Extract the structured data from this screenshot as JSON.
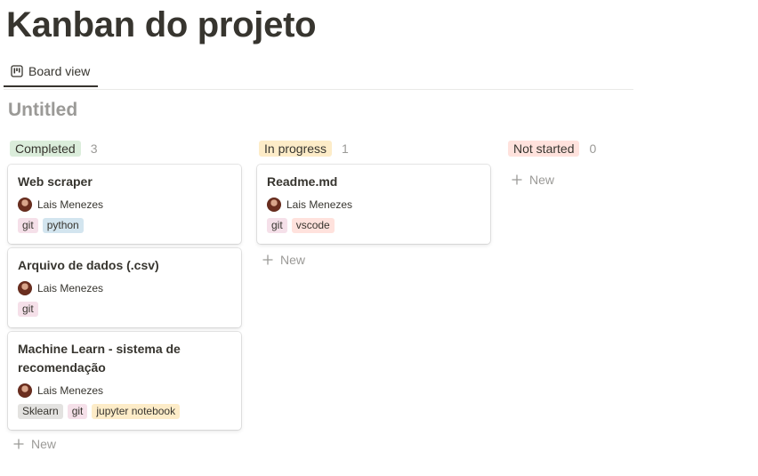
{
  "page": {
    "title": "Kanban do projeto"
  },
  "tabs": [
    {
      "label": "Board view",
      "icon": "board-icon"
    }
  ],
  "view": {
    "title": "Untitled"
  },
  "colors": {
    "text": "#37352f",
    "muted": "#9b9a97"
  },
  "columns": [
    {
      "status": "Completed",
      "count": "3",
      "color": "#dbeddb",
      "cards": [
        {
          "title": "Web scraper",
          "person": "Lais Menezes",
          "tags": [
            {
              "label": "git",
              "color": "pink"
            },
            {
              "label": "python",
              "color": "blue"
            }
          ]
        },
        {
          "title": "Arquivo de dados (.csv)",
          "person": "Lais Menezes",
          "tags": [
            {
              "label": "git",
              "color": "pink"
            }
          ]
        },
        {
          "title": "Machine Learn - sistema de recomendação",
          "person": "Lais Menezes",
          "tags": [
            {
              "label": "Sklearn",
              "color": "gray"
            },
            {
              "label": "git",
              "color": "pink"
            },
            {
              "label": "jupyter notebook",
              "color": "yellow"
            }
          ]
        }
      ],
      "new_label": "New"
    },
    {
      "status": "In progress",
      "count": "1",
      "color": "#fdecc8",
      "cards": [
        {
          "title": "Readme.md",
          "person": "Lais Menezes",
          "tags": [
            {
              "label": "git",
              "color": "pink"
            },
            {
              "label": "vscode",
              "color": "red"
            }
          ]
        }
      ],
      "new_label": "New"
    },
    {
      "status": "Not started",
      "count": "0",
      "color": "#ffe2dd",
      "cards": [],
      "new_label": "New"
    }
  ]
}
